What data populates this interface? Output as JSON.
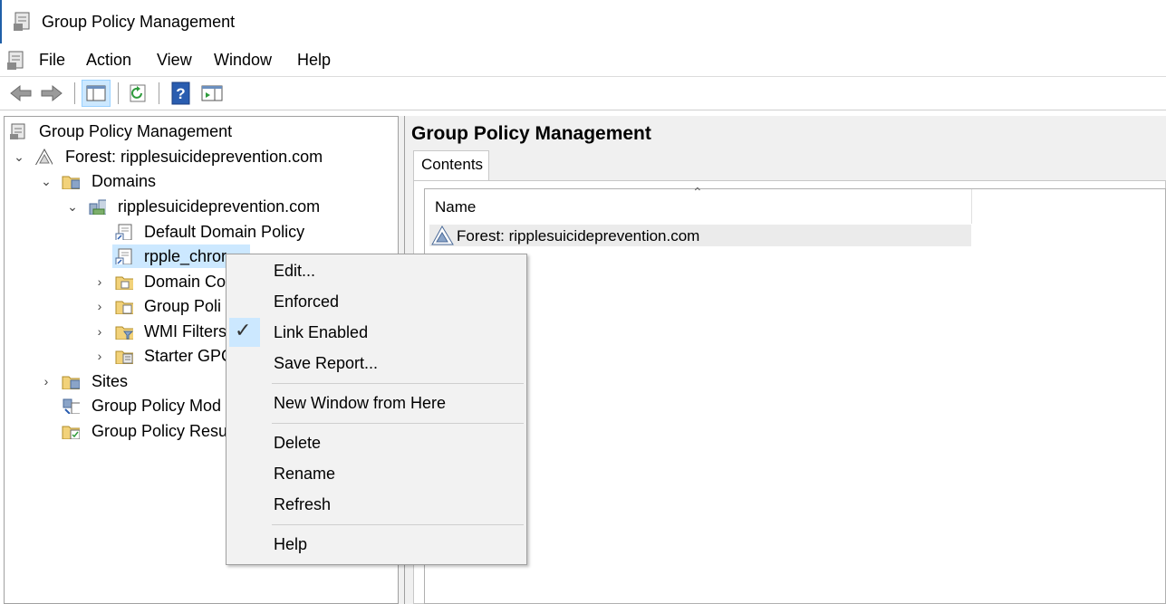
{
  "window": {
    "title": "Group Policy Management"
  },
  "menubar": {
    "items": [
      "File",
      "Action",
      "View",
      "Window",
      "Help"
    ]
  },
  "tree": {
    "root": "Group Policy Management",
    "forest": "Forest: ripplesuicideprevention.com",
    "domains": "Domains",
    "domain": "ripplesuicideprevention.com",
    "default_policy": "Default Domain Policy",
    "selected_gpo": "rpple_chror",
    "domain_controllers": "Domain Co",
    "gpo_folder": "Group Poli",
    "wmi_filters": "WMI Filters",
    "starter_gpos": "Starter GPC",
    "sites": "Sites",
    "modeling": "Group Policy Mod",
    "results": "Group Policy Resu"
  },
  "right": {
    "title": "Group Policy Management",
    "tab": "Contents",
    "column_name": "Name",
    "row": "Forest: ripplesuicideprevention.com"
  },
  "context_menu": {
    "edit": "Edit...",
    "enforced": "Enforced",
    "link_enabled": "Link Enabled",
    "save_report": "Save Report...",
    "new_window": "New Window from Here",
    "delete": "Delete",
    "rename": "Rename",
    "refresh": "Refresh",
    "help": "Help",
    "link_enabled_checked": true
  },
  "colors": {
    "selection": "#cce8ff",
    "accent": "#1f5fa8"
  }
}
